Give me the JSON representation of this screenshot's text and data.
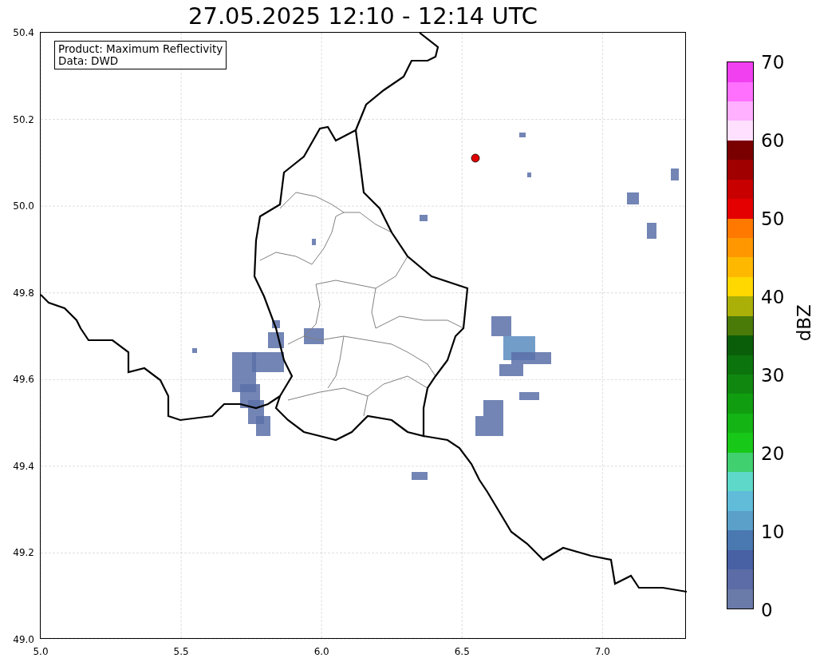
{
  "title": "27.05.2025 12:10 - 12:14 UTC",
  "info_box": [
    "Product: Maximum Reflectivity",
    "Data: DWD"
  ],
  "map": {
    "x_ticks": [
      "5.0",
      "5.5",
      "6.0",
      "6.5",
      "7.0"
    ],
    "y_ticks": [
      "50.4",
      "50.2",
      "50.0",
      "49.8",
      "49.6",
      "49.4",
      "49.2",
      "49.0"
    ]
  },
  "colorbar": {
    "label": "dBZ",
    "ticks": [
      "70",
      "60",
      "50",
      "40",
      "30",
      "20",
      "10",
      "0"
    ],
    "bands": [
      {
        "color": "#6a7aa9"
      },
      {
        "color": "#5b6ca6"
      },
      {
        "color": "#4860a4"
      },
      {
        "color": "#4a78b0"
      },
      {
        "color": "#5aa0c8"
      },
      {
        "color": "#60bcd8"
      },
      {
        "color": "#5ed8c8"
      },
      {
        "color": "#40d070"
      },
      {
        "color": "#18c818"
      },
      {
        "color": "#14b414"
      },
      {
        "color": "#109e10"
      },
      {
        "color": "#108810"
      },
      {
        "color": "#0c740c"
      },
      {
        "color": "#0a5e0a"
      },
      {
        "color": "#4a7a08"
      },
      {
        "color": "#aab008"
      },
      {
        "color": "#ffd800"
      },
      {
        "color": "#ffb800"
      },
      {
        "color": "#ff9800"
      },
      {
        "color": "#ff7800"
      },
      {
        "color": "#e40000"
      },
      {
        "color": "#c80000"
      },
      {
        "color": "#a00000"
      },
      {
        "color": "#7a0000"
      },
      {
        "color": "#ffe0ff"
      },
      {
        "color": "#ffb0ff"
      },
      {
        "color": "#ff70ff"
      },
      {
        "color": "#f040f0"
      }
    ]
  }
}
